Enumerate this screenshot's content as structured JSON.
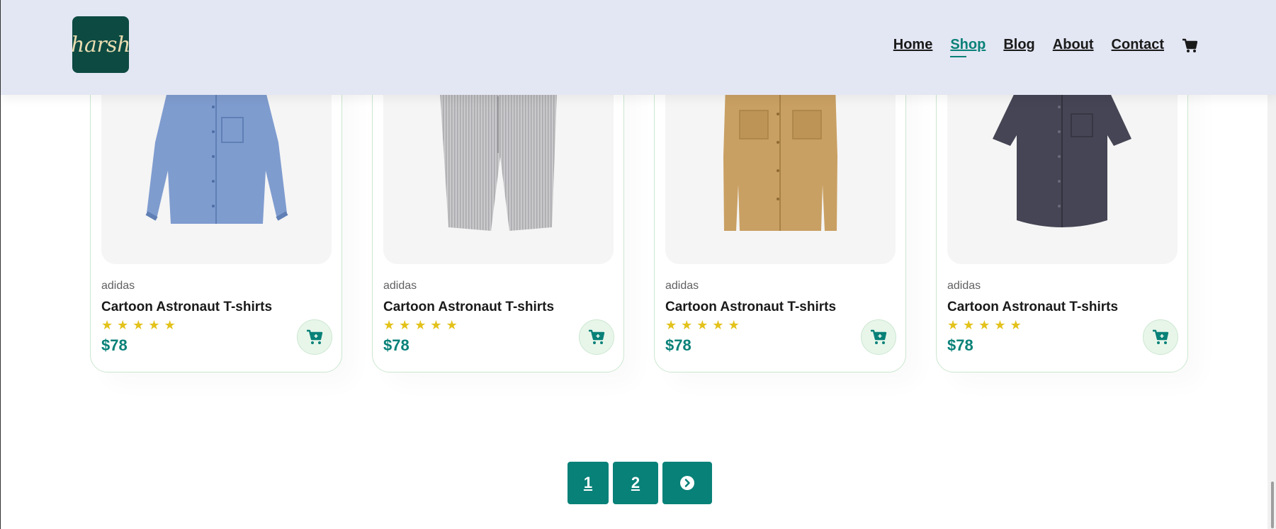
{
  "header": {
    "logo_text": "harsh",
    "nav": [
      "Home",
      "Shop",
      "Blog",
      "About",
      "Contact"
    ],
    "active_nav": "Shop"
  },
  "products": [
    {
      "brand": "adidas",
      "title": "Cartoon Astronaut T-shirts",
      "rating": 5,
      "price": "$78",
      "image": "blue-denim-shirt"
    },
    {
      "brand": "adidas",
      "title": "Cartoon Astronaut T-shirts",
      "rating": 5,
      "price": "$78",
      "image": "grey-striped-shorts"
    },
    {
      "brand": "adidas",
      "title": "Cartoon Astronaut T-shirts",
      "rating": 5,
      "price": "$78",
      "image": "tan-utility-shirt"
    },
    {
      "brand": "adidas",
      "title": "Cartoon Astronaut T-shirts",
      "rating": 5,
      "price": "$78",
      "image": "navy-short-sleeve-shirt"
    }
  ],
  "pagination": {
    "pages": [
      "1",
      "2"
    ],
    "next_icon": "chevron-right-circle-icon"
  },
  "colors": {
    "accent": "#088178",
    "header_bg": "#e3e6f3",
    "star": "#e3c21b",
    "logo_bg": "#0d4a42"
  }
}
